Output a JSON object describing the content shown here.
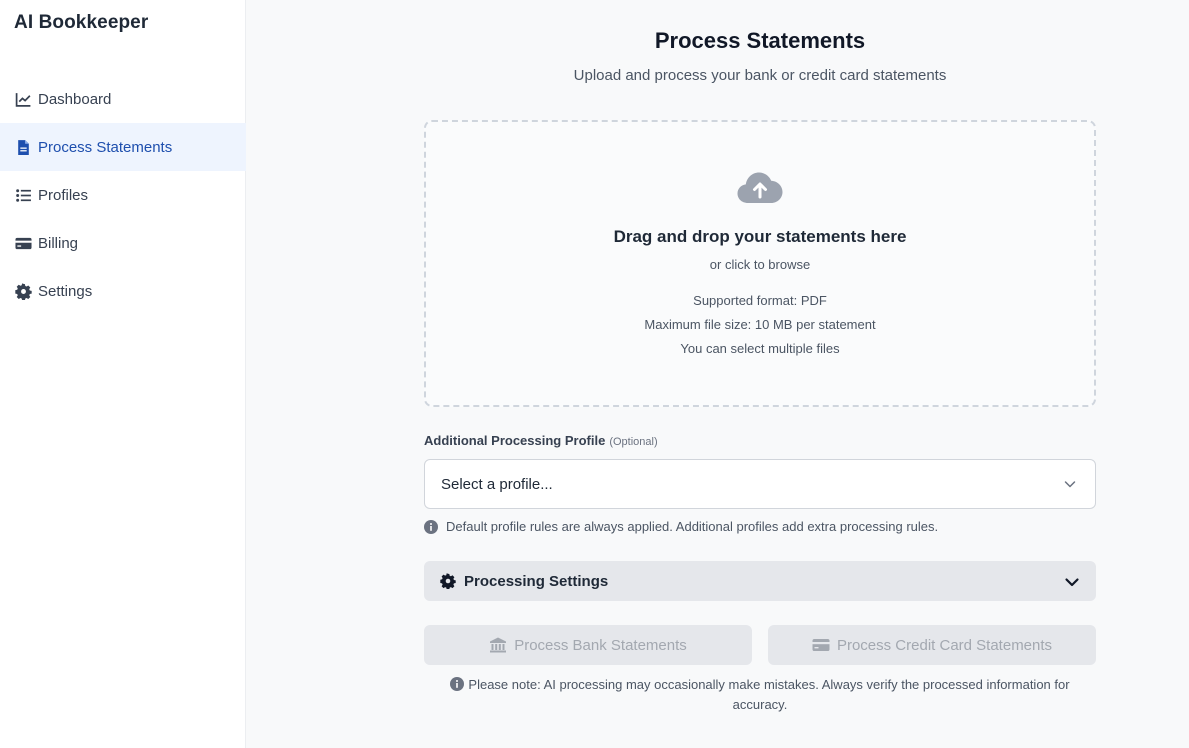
{
  "app": {
    "title": "AI Bookkeeper"
  },
  "sidebar": {
    "items": [
      {
        "label": "Dashboard",
        "icon": "chart-line-icon"
      },
      {
        "label": "Process Statements",
        "icon": "document-icon",
        "active": true
      },
      {
        "label": "Profiles",
        "icon": "list-icon"
      },
      {
        "label": "Billing",
        "icon": "credit-card-icon"
      },
      {
        "label": "Settings",
        "icon": "gear-icon"
      }
    ]
  },
  "main": {
    "title": "Process Statements",
    "subtitle": "Upload and process your bank or credit card statements",
    "dropzone": {
      "title": "Drag and drop your statements here",
      "browse": "or click to browse",
      "format": "Supported format: PDF",
      "max_size": "Maximum file size: 10 MB per statement",
      "multiple": "You can select multiple files"
    },
    "profile": {
      "label": "Additional Processing Profile",
      "optional": "(Optional)",
      "placeholder": "Select a profile...",
      "hint": "Default profile rules are always applied. Additional profiles add extra processing rules."
    },
    "settings": {
      "label": "Processing Settings"
    },
    "buttons": {
      "bank": "Process Bank Statements",
      "credit_card": "Process Credit Card Statements"
    },
    "note": "Please note: AI processing may occasionally make mistakes. Always verify the processed information for accuracy."
  },
  "colors": {
    "active_bg": "#eef4fe",
    "active_text": "#1e4fae",
    "disabled_button_bg": "#e5e7eb",
    "disabled_button_text": "#a3a8b0"
  }
}
